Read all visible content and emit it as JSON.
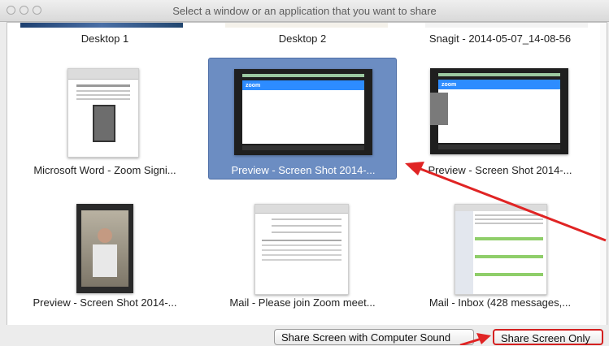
{
  "window": {
    "title": "Select a window or an application that you want to share"
  },
  "top_row": [
    {
      "label": "Desktop 1"
    },
    {
      "label": "Desktop 2"
    },
    {
      "label": "Snagit - 2014-05-07_14-08-56"
    }
  ],
  "tiles": [
    {
      "label": "Microsoft Word - Zoom Signi...",
      "icon": "word-document-thumbnail",
      "selected": false
    },
    {
      "label": "Preview - Screen Shot 2014-...",
      "icon": "zoom-screenshot-thumbnail",
      "selected": true
    },
    {
      "label": "Preview - Screen Shot 2014-...",
      "icon": "zoom-screenshot-thumbnail",
      "selected": false
    },
    {
      "label": "Preview - Screen Shot 2014-...",
      "icon": "video-photo-thumbnail",
      "selected": false
    },
    {
      "label": "Mail - Please join Zoom meet...",
      "icon": "mail-compose-thumbnail",
      "selected": false
    },
    {
      "label": "Mail - Inbox (428 messages,...",
      "icon": "mail-inbox-thumbnail",
      "selected": false
    }
  ],
  "buttons": {
    "share_with_sound": "Share Screen with Computer Sound",
    "share_only": "Share Screen Only"
  },
  "colors": {
    "selection": "#6c8dc2",
    "annotation_arrow": "#e02424"
  }
}
